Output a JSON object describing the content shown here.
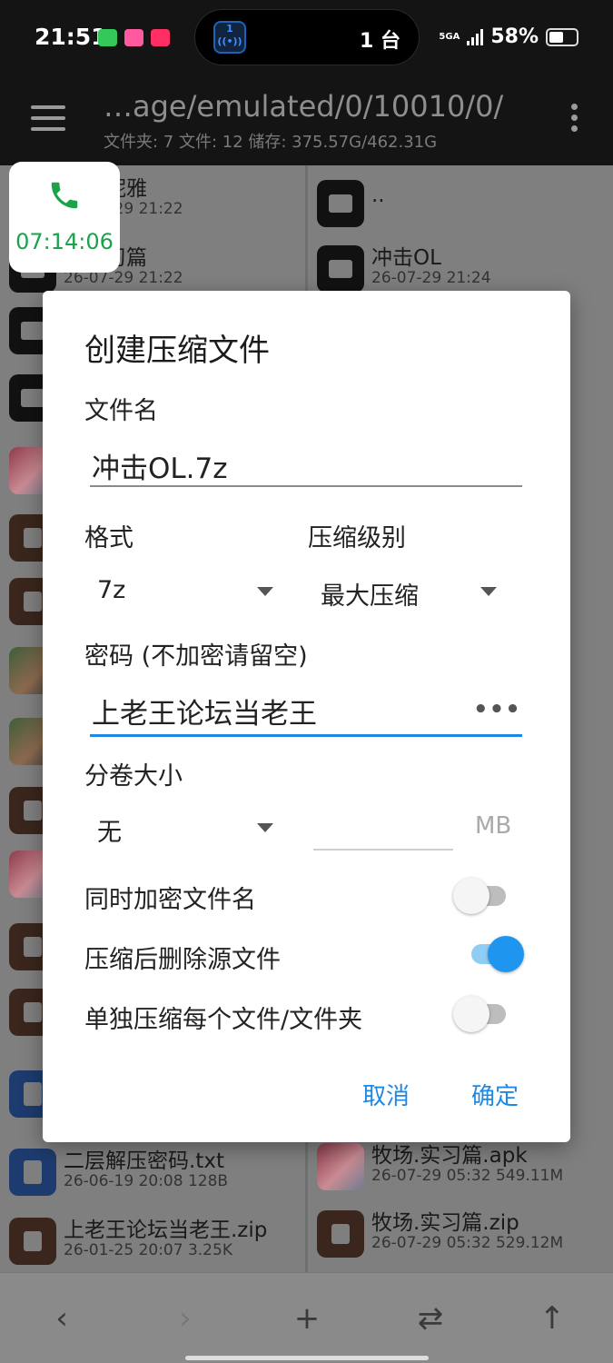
{
  "status_bar": {
    "time": "21:51",
    "island_badge": "1",
    "island_text": "1 台",
    "network": "5GA",
    "battery": "58%"
  },
  "app_bar": {
    "path": "…age/emulated/0/10010/0/",
    "stats": "文件夹: 7  文件: 12  储存: 375.57G/462.31G"
  },
  "call_overlay": {
    "timer": "07:14:06"
  },
  "left_pane": [
    {
      "name": "…去妮雅",
      "meta": "26-07-29 21:22"
    },
    {
      "name": "…实习篇",
      "meta": "26-07-29 21:22"
    },
    {
      "name": "二层解压密码.txt",
      "meta": "26-06-19 20:08  128B"
    },
    {
      "name": "上老王论坛当老王.zip",
      "meta": "26-01-25 20:07  3.25K"
    }
  ],
  "right_pane": [
    {
      "name": "..",
      "meta": ""
    },
    {
      "name": "冲击OL",
      "meta": "26-07-29 21:24"
    },
    {
      "name": "牧场.实习篇.apk",
      "meta": "26-07-29 05:32  549.11M"
    },
    {
      "name": "牧场.实习篇.zip",
      "meta": "26-07-29 05:32  529.12M"
    },
    {
      "name": "…",
      "meta": ""
    }
  ],
  "dialog": {
    "title": "创建压缩文件",
    "filename_label": "文件名",
    "filename_value": "冲击OL.7z",
    "format_label": "格式",
    "format_value": "7z",
    "level_label": "压缩级别",
    "level_value": "最大压缩",
    "password_label": "密码 (不加密请留空)",
    "password_value": "上老王论坛当老王",
    "password_toggle": "•••",
    "split_label": "分卷大小",
    "split_value": "无",
    "split_unit": "MB",
    "opt_encrypt_names": "同时加密文件名",
    "opt_delete_source": "压缩后删除源文件",
    "opt_separate": "单独压缩每个文件/文件夹",
    "cancel": "取消",
    "ok": "确定",
    "switch_states": {
      "encrypt_names": false,
      "delete_source": true,
      "separate": false
    }
  },
  "colors": {
    "accent": "#1e88e5",
    "call_green": "#1aa34a"
  }
}
